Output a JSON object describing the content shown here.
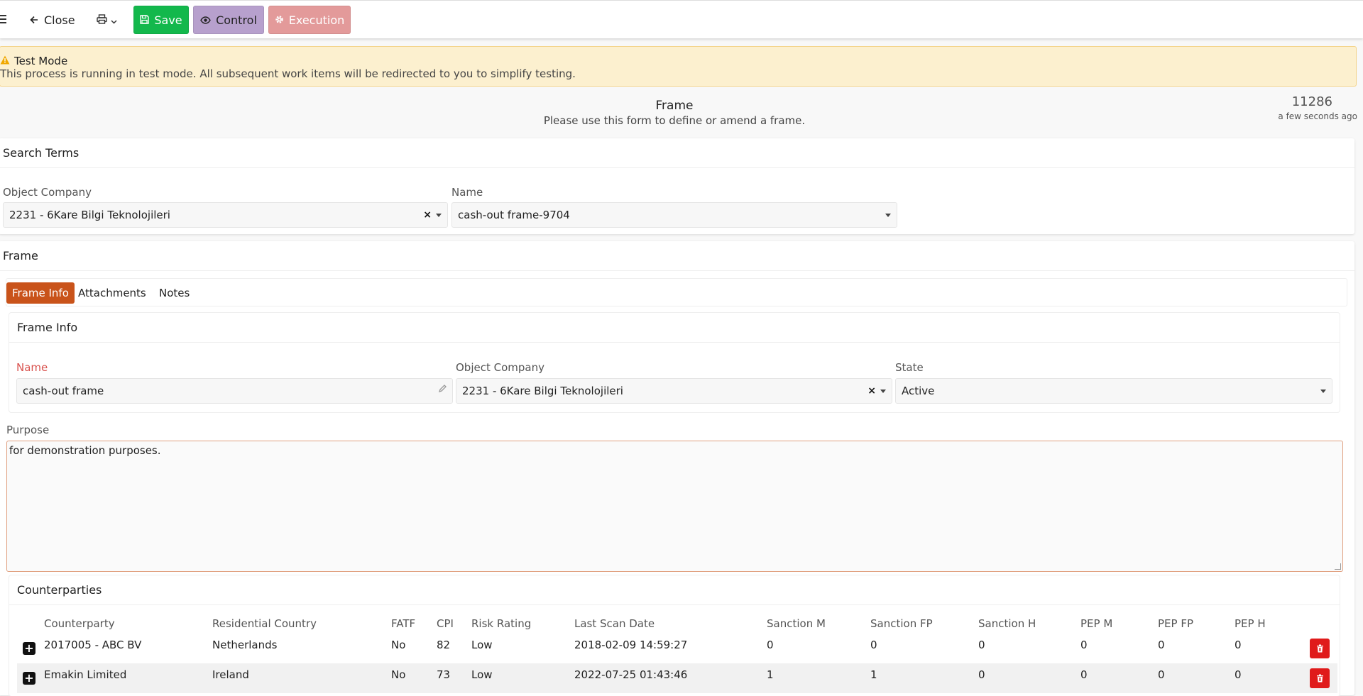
{
  "toolbar": {
    "close_label": "Close",
    "save_label": "Save",
    "control_label": "Control",
    "execution_label": "Execution"
  },
  "alert": {
    "title": "Test Mode",
    "text": "This process is running in test mode. All subsequent work items will be redirected to you to simplify testing."
  },
  "header": {
    "title": "Frame",
    "subtitle": "Please use this form to define or amend a frame.",
    "record_id": "11286",
    "updated": "a few seconds ago"
  },
  "search_terms": {
    "heading": "Search Terms",
    "object_company_label": "Object Company",
    "object_company_value": "2231 - 6Kare Bilgi Teknolojileri",
    "name_label": "Name",
    "name_value": "cash-out frame-9704"
  },
  "frame": {
    "heading": "Frame",
    "tabs": [
      {
        "label": "Frame Info"
      },
      {
        "label": "Attachments"
      },
      {
        "label": "Notes"
      }
    ],
    "info": {
      "heading": "Frame Info",
      "name_label": "Name",
      "name_value": "cash-out frame",
      "object_company_label": "Object Company",
      "object_company_value": "2231 - 6Kare Bilgi Teknolojileri",
      "state_label": "State",
      "state_value": "Active"
    },
    "purpose_label": "Purpose",
    "purpose_value": "for demonstration purposes."
  },
  "counterparties": {
    "heading": "Counterparties",
    "columns": [
      "Counterparty",
      "Residential Country",
      "FATF",
      "CPI",
      "Risk Rating",
      "Last Scan Date",
      "Sanction M",
      "Sanction FP",
      "Sanction H",
      "PEP M",
      "PEP FP",
      "PEP H"
    ],
    "rows": [
      [
        "2017005 - ABC BV",
        "Netherlands",
        "No",
        "82",
        "Low",
        "2018-02-09 14:59:27",
        "0",
        "0",
        "0",
        "0",
        "0",
        "0"
      ],
      [
        "Emakin Limited",
        "Ireland",
        "No",
        "73",
        "Low",
        "2022-07-25 01:43:46",
        "1",
        "1",
        "0",
        "0",
        "0",
        "0"
      ]
    ]
  },
  "colors": {
    "save": "#13b84c",
    "control": "#b7a0cd",
    "execution": "#e39a9a",
    "active_tab": "#c9531a",
    "delete": "#e01b1b",
    "alert_bg": "#fcf0cf"
  }
}
